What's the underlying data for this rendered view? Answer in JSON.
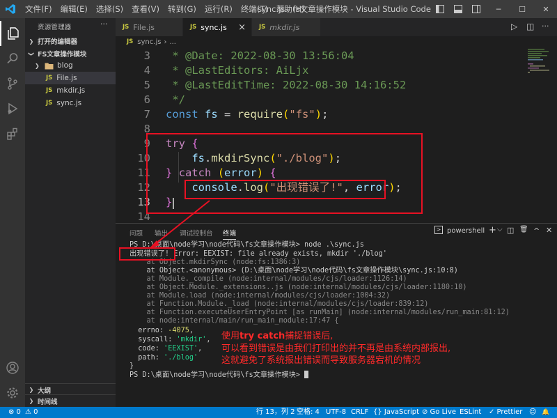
{
  "titlebar": {
    "menu": [
      "文件(F)",
      "编辑(E)",
      "选择(S)",
      "查看(V)",
      "转到(G)",
      "运行(R)",
      "终端(T)",
      "帮助(H)"
    ],
    "window_title": "sync.js - fs文章操作模块 - Visual Studio Code",
    "controls": {
      "minimize": "─",
      "maximize": "☐",
      "close": "✕"
    }
  },
  "activitybar": {
    "icons": [
      "explorer-icon",
      "search-icon",
      "source-control-icon",
      "run-debug-icon",
      "extensions-icon",
      "account-icon",
      "settings-gear-icon"
    ]
  },
  "sidebar": {
    "title": "资源管理器",
    "more": "···",
    "open_editors": "打开的编辑器",
    "folder": "FS文章操作模块",
    "items": [
      {
        "type": "folder",
        "label": "blog"
      },
      {
        "type": "js",
        "label": "File.js"
      },
      {
        "type": "js",
        "label": "mkdir.js"
      },
      {
        "type": "js",
        "label": "sync.js"
      }
    ],
    "outline": "大纲",
    "timeline": "时间线",
    "js_badge": "JS"
  },
  "tabs": [
    {
      "label": "File.js",
      "active": false,
      "italic": false
    },
    {
      "label": "sync.js",
      "active": true,
      "italic": false
    },
    {
      "label": "mkdir.js",
      "active": false,
      "italic": true
    }
  ],
  "tab_close": "×",
  "editor_actions": {
    "run": "▷",
    "split": "◫",
    "more": "···"
  },
  "breadcrumb": {
    "badge": "JS",
    "file": "sync.js",
    "sep": "›",
    "more": "..."
  },
  "editor": {
    "lines": [
      {
        "n": "3",
        "text": " * @Date: 2022-08-30 13:56:04"
      },
      {
        "n": "4",
        "text": " * @LastEditors: AiLjx"
      },
      {
        "n": "5",
        "text": " * @LastEditTime: 2022-08-30 14:16:52"
      },
      {
        "n": "6",
        "text": " */"
      },
      {
        "n": "7",
        "text": "const fs = require(\"fs\");"
      },
      {
        "n": "8",
        "text": ""
      },
      {
        "n": "9",
        "text": "try {"
      },
      {
        "n": "10",
        "text": "    fs.mkdirSync(\"./blog\");"
      },
      {
        "n": "11",
        "text": "} catch (error) {"
      },
      {
        "n": "12",
        "text": "    console.log(\"出现错误了!\", error);"
      },
      {
        "n": "13",
        "text": "}"
      },
      {
        "n": "14",
        "text": ""
      }
    ],
    "active_line": "13"
  },
  "panel": {
    "tabs": [
      "问题",
      "输出",
      "调试控制台",
      "终端"
    ],
    "active_tab": "终端",
    "terminal_name": "powershell",
    "actions": [
      "+",
      "⌵",
      "◫",
      "🗑",
      "^",
      "✕"
    ]
  },
  "terminal": {
    "lines": [
      {
        "t": "PS D:\\桌面\\node学习\\node代码\\fs文章操作模块> node .\\sync.js",
        "cls": ""
      },
      {
        "t": "出现错误了! Error: EEXIST: file already exists, mkdir './blog'",
        "cls": ""
      },
      {
        "t": "    at Object.mkdirSync (node:fs:1386:3)",
        "cls": "t-dim"
      },
      {
        "t": "    at Object.<anonymous> (D:\\桌面\\node学习\\node代码\\fs文章操作模块\\sync.js:10:8)",
        "cls": ""
      },
      {
        "t": "    at Module._compile (node:internal/modules/cjs/loader:1126:14)",
        "cls": "t-dim"
      },
      {
        "t": "    at Object.Module._extensions..js (node:internal/modules/cjs/loader:1180:10)",
        "cls": "t-dim"
      },
      {
        "t": "    at Module.load (node:internal/modules/cjs/loader:1004:32)",
        "cls": "t-dim"
      },
      {
        "t": "    at Function.Module._load (node:internal/modules/cjs/loader:839:12)",
        "cls": "t-dim"
      },
      {
        "t": "    at Function.executeUserEntryPoint [as runMain] (node:internal/modules/run_main:81:12)",
        "cls": "t-dim"
      },
      {
        "t": "    at node:internal/main/run_main_module:17:47 {",
        "cls": "t-dim"
      },
      {
        "t": "  errno: -4075,",
        "cls": ""
      },
      {
        "t": "  syscall: 'mkdir',",
        "cls": ""
      },
      {
        "t": "  code: 'EEXIST',",
        "cls": ""
      },
      {
        "t": "  path: './blog'",
        "cls": ""
      },
      {
        "t": "}",
        "cls": ""
      },
      {
        "t": "PS D:\\桌面\\node学习\\node代码\\fs文章操作模块> ",
        "cls": ""
      }
    ]
  },
  "annotation": {
    "line1_prefix": "使用",
    "line1_bold": "try catch",
    "line1_suffix": "捕捉错误后,",
    "line2": "可以看到错误是由我们打印出的并不再是由系统内部报出,",
    "line3": "这就避免了系统报出错误而导致服务器宕机的情况"
  },
  "statusbar": {
    "errors": "⊗ 0",
    "warnings": "⚠ 0",
    "position": "行 13，列 2",
    "spaces": "空格: 4",
    "encoding": "UTF-8",
    "eol": "CRLF",
    "language": "{} JavaScript",
    "golive": "⊘ Go Live",
    "eslint": "ESLint",
    "prettier": "✓ Prettier",
    "feedback": "☺",
    "bell": "🔔"
  },
  "colors": {
    "accent": "#007acc",
    "annotation": "#e81123"
  }
}
